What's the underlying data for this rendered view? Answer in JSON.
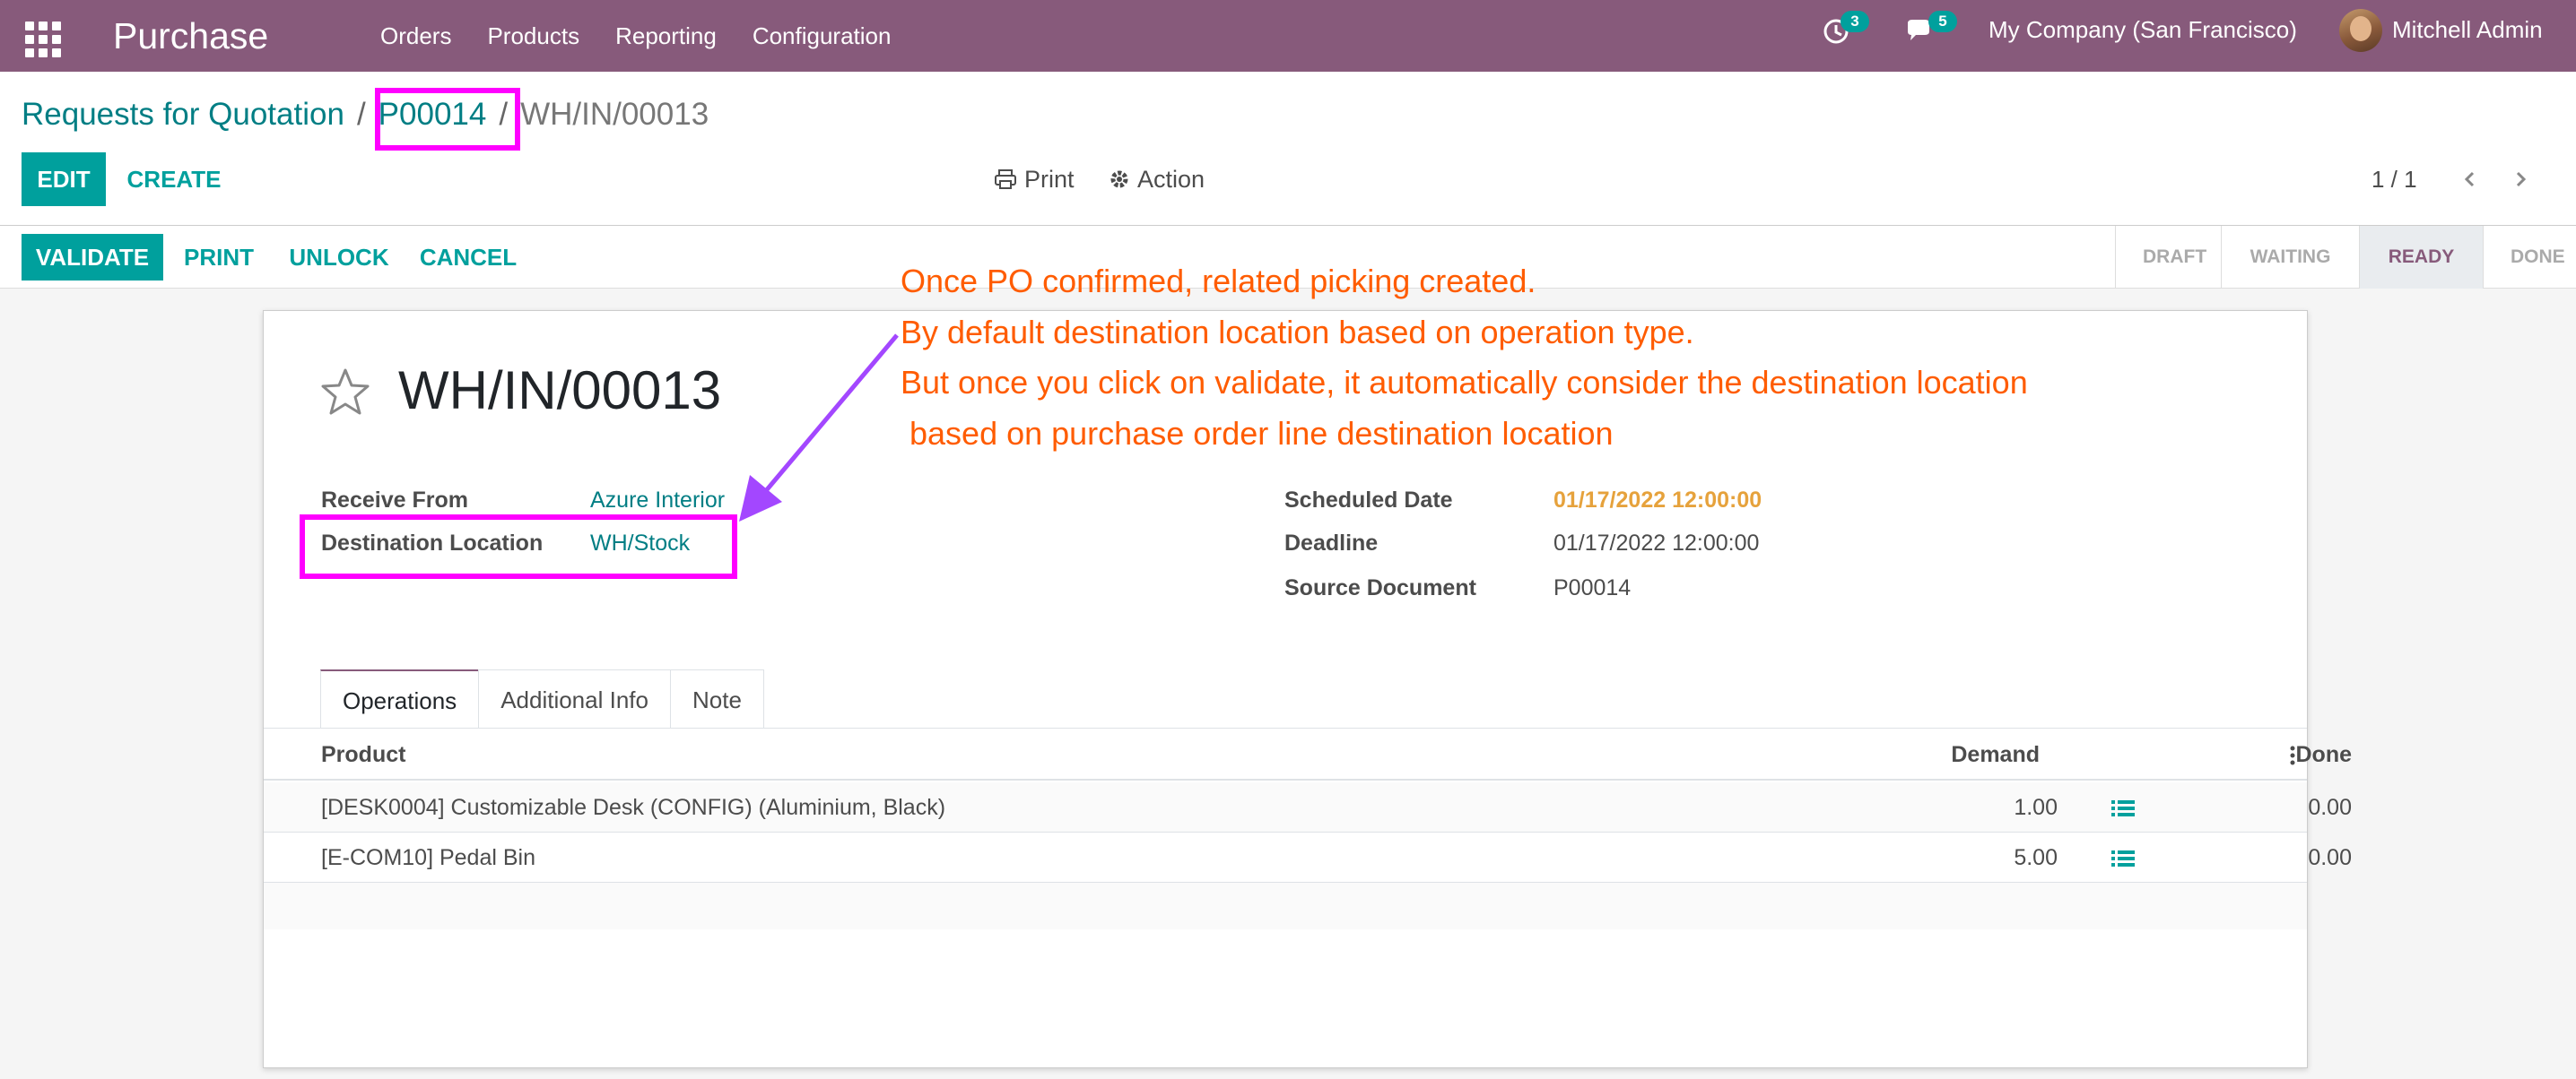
{
  "navbar": {
    "app_name": "Purchase",
    "menu": [
      "Orders",
      "Products",
      "Reporting",
      "Configuration"
    ],
    "activity_count": "3",
    "message_count": "5",
    "company": "My Company (San Francisco)",
    "user": "Mitchell Admin"
  },
  "breadcrumb": {
    "parent": "Requests for Quotation",
    "middle": "P00014",
    "separator": "/",
    "current": "WH/IN/00013"
  },
  "control": {
    "edit": "EDIT",
    "create": "CREATE",
    "print": "Print",
    "action": "Action",
    "pager": "1 / 1"
  },
  "statusbar": {
    "buttons": {
      "validate": "VALIDATE",
      "print": "PRINT",
      "unlock": "UNLOCK",
      "cancel": "CANCEL"
    },
    "steps": [
      "DRAFT",
      "WAITING",
      "READY",
      "DONE"
    ],
    "active_step": "READY"
  },
  "record": {
    "name": "WH/IN/00013",
    "receive_from_label": "Receive From",
    "receive_from": "Azure Interior",
    "destination_label": "Destination Location",
    "destination": "WH/Stock",
    "scheduled_date_label": "Scheduled Date",
    "scheduled_date": "01/17/2022 12:00:00",
    "deadline_label": "Deadline",
    "deadline": "01/17/2022 12:00:00",
    "source_label": "Source Document",
    "source": "P00014"
  },
  "tabs": [
    "Operations",
    "Additional Info",
    "Note"
  ],
  "table": {
    "headers": {
      "product": "Product",
      "demand": "Demand",
      "done": "Done"
    },
    "rows": [
      {
        "product": "[DESK0004] Customizable Desk (CONFIG) (Aluminium, Black)",
        "demand": "1.00",
        "done": "0.00"
      },
      {
        "product": "[E-COM10] Pedal Bin",
        "demand": "5.00",
        "done": "0.00"
      }
    ]
  },
  "annotation": {
    "line1": "Once PO confirmed, related picking created.",
    "line2": "By default destination location based on operation type.",
    "line3": "But once you click on validate, it automatically consider the destination location",
    "line4": " based on purchase order line destination location",
    "color": "#ff5c00",
    "highlight_color": "#ff00ff"
  }
}
